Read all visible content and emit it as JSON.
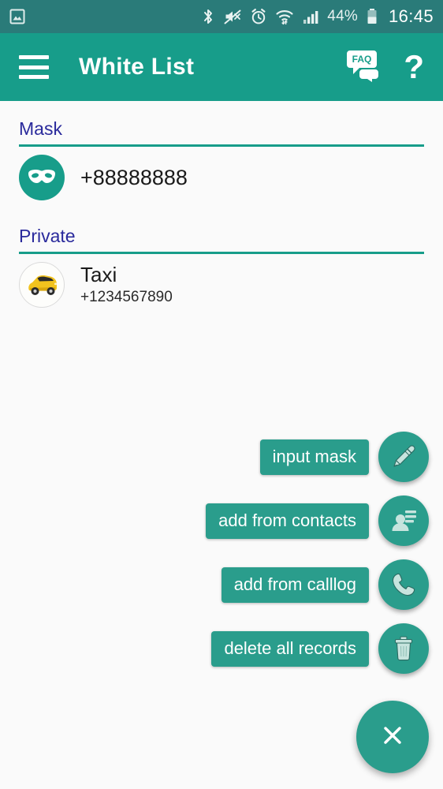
{
  "status_bar": {
    "left_icons": [
      "image-icon"
    ],
    "right_icons": [
      "bluetooth-icon",
      "sound-mute-icon",
      "alarm-clock-icon",
      "wifi-icon",
      "cell-signal-icon"
    ],
    "battery_percent": "44%",
    "clock": "16:45",
    "background_color": "#2a7b79"
  },
  "toolbar": {
    "menu_icon": "hamburger-menu-icon",
    "title": "White List",
    "faq_icon": "faq-speech-bubble-icon",
    "help_label": "?",
    "background_color": "#179d8a"
  },
  "sections": [
    {
      "title": "Mask",
      "items": [
        {
          "icon": "mask-icon",
          "primary": "+88888888",
          "secondary": ""
        }
      ]
    },
    {
      "title": "Private",
      "items": [
        {
          "icon": "taxi-car-avatar",
          "primary": "Taxi",
          "secondary": "+1234567890"
        }
      ]
    }
  ],
  "fab_menu": {
    "expanded": true,
    "actions": [
      {
        "label": "input mask",
        "icon": "pencil-icon"
      },
      {
        "label": "add from contacts",
        "icon": "contacts-icon"
      },
      {
        "label": "add from calllog",
        "icon": "phone-handset-icon"
      },
      {
        "label": "delete all records",
        "icon": "trash-icon"
      }
    ],
    "main_button": {
      "icon": "close-x-icon",
      "label": ""
    }
  },
  "colors": {
    "accent": "#179d8a",
    "fab": "#2a9d8c",
    "status_bar": "#2a7b79",
    "section_title": "#2a2a9c",
    "background": "#fafafa"
  }
}
